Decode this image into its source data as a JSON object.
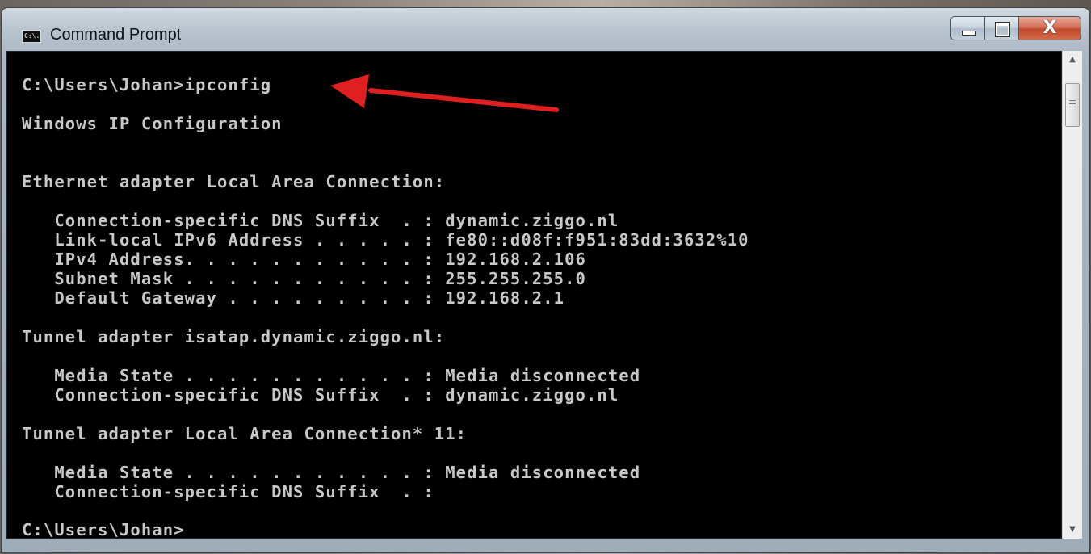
{
  "window": {
    "title": "Command Prompt",
    "icon": "cmd-icon",
    "icon_text": "C:\\."
  },
  "controls": {
    "minimize_icon": "minimize-icon",
    "maximize_icon": "maximize-icon",
    "close_icon": "close-icon",
    "close_glyph": "X"
  },
  "console": {
    "lines": [
      "C:\\Users\\Johan>ipconfig",
      "Windows IP Configuration",
      "Ethernet adapter Local Area Connection:",
      "   Connection-specific DNS Suffix  . : dynamic.ziggo.nl",
      "   Link-local IPv6 Address . . . . . : fe80::d08f:f951:83dd:3632%10",
      "   IPv4 Address. . . . . . . . . . . : 192.168.2.106",
      "   Subnet Mask . . . . . . . . . . . : 255.255.255.0",
      "   Default Gateway . . . . . . . . . : 192.168.2.1",
      "Tunnel adapter isatap.dynamic.ziggo.nl:",
      "   Media State . . . . . . . . . . . : Media disconnected",
      "   Connection-specific DNS Suffix  . : dynamic.ziggo.nl",
      "Tunnel adapter Local Area Connection* 11:",
      "   Media State . . . . . . . . . . . : Media disconnected",
      "   Connection-specific DNS Suffix  . :",
      "C:\\Users\\Johan>"
    ]
  },
  "annotation": {
    "icon": "red-arrow-icon",
    "color": "#e02020"
  },
  "colors": {
    "console_bg": "#000000",
    "console_text": "#c8c8c8"
  },
  "scrollbar": {
    "up_icon": "scroll-up-icon",
    "down_icon": "scroll-down-icon"
  }
}
